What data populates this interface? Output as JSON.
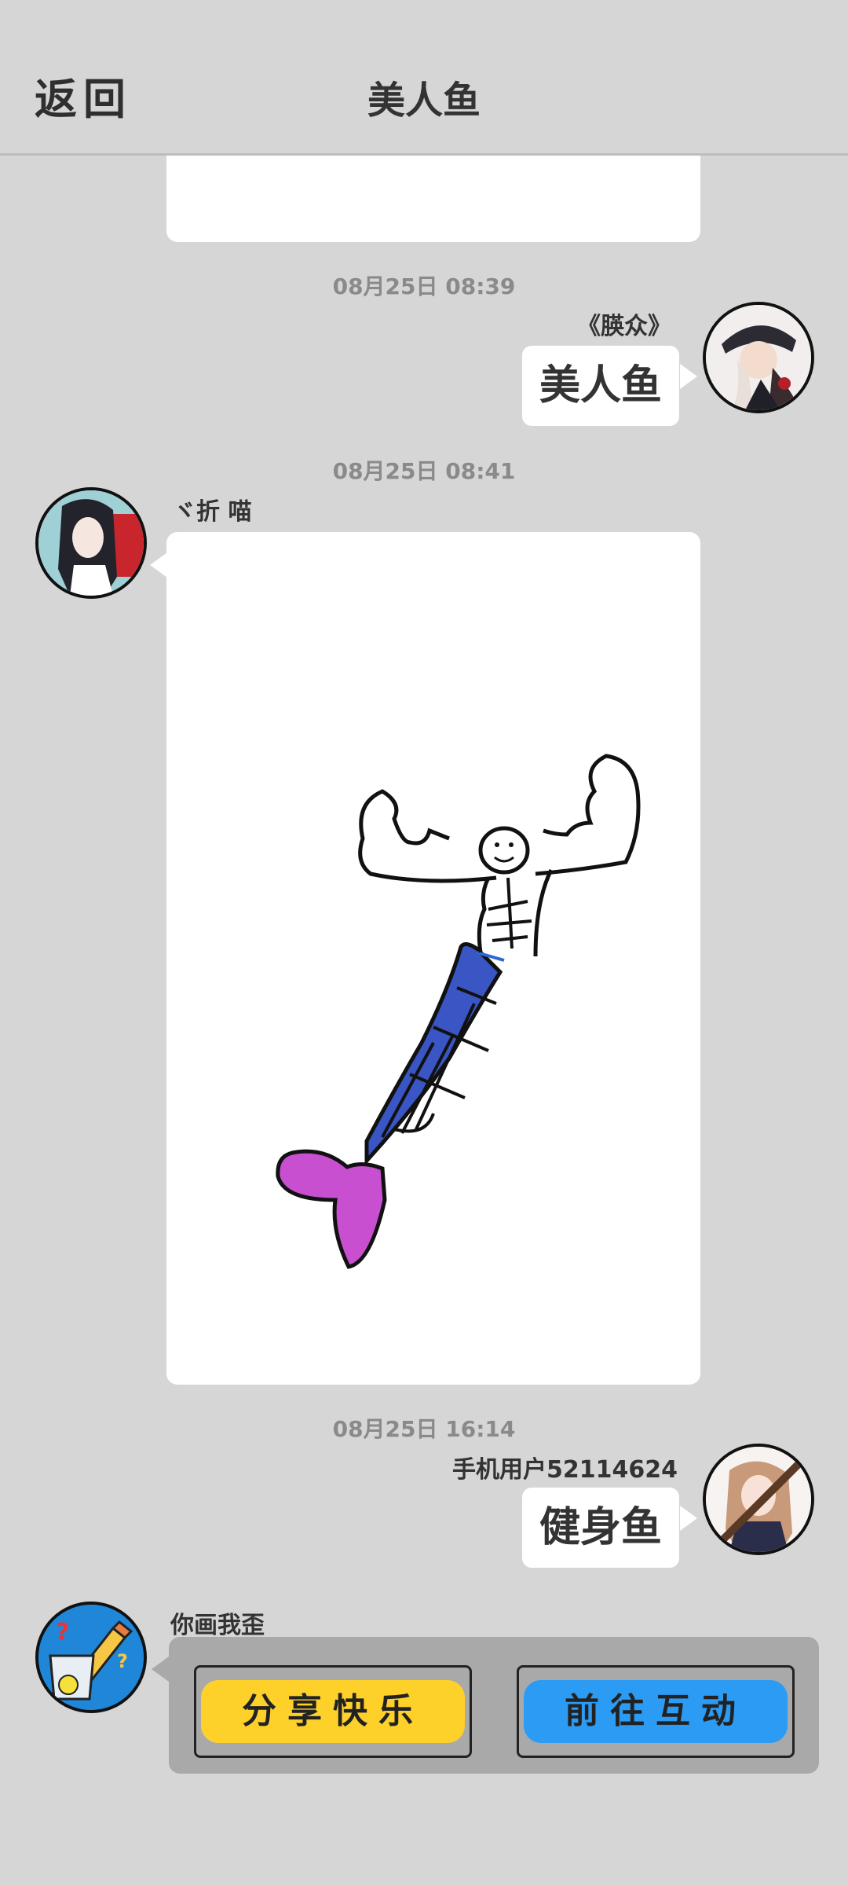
{
  "header": {
    "back_label": "返回",
    "title": "美人鱼"
  },
  "messages": [
    {
      "type": "image-tail"
    },
    {
      "time": "08月25日  08:39",
      "sender": "《朠众》",
      "side": "right",
      "text": "美人鱼"
    },
    {
      "time": "08月25日  08:41",
      "sender": "ヾ折 喵",
      "side": "left",
      "image": "mermaid-drawing"
    },
    {
      "time": "08月25日  16:14",
      "sender": "手机用户52114624",
      "side": "right",
      "text": "健身鱼"
    }
  ],
  "bot": {
    "name": "你画我歪",
    "share_label": "分享快乐",
    "interact_label": "前往互动"
  },
  "colors": {
    "background": "#d6d6d6",
    "share_button": "#fdd02a",
    "interact_button": "#2b9bf4",
    "tail_fin": "#c84fcf",
    "tail_body": "#3a55c4"
  }
}
